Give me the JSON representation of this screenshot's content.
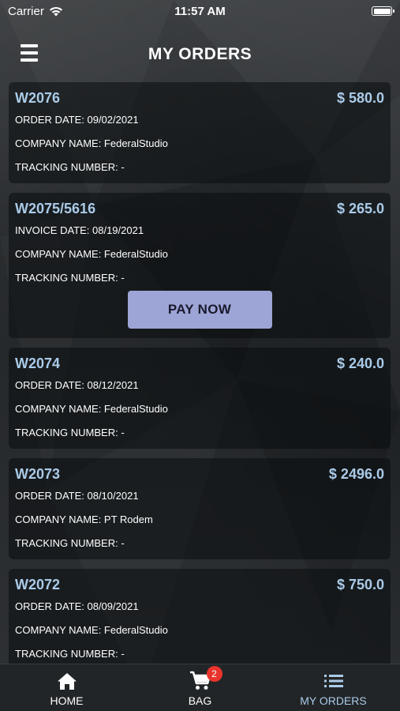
{
  "status_bar": {
    "carrier": "Carrier",
    "time": "11:57 AM"
  },
  "header": {
    "title": "MY ORDERS",
    "menu_icon": "hamburger-menu-icon"
  },
  "orders": [
    {
      "id": "W2076",
      "amount": "$ 580.0",
      "date_line": "ORDER DATE: 09/02/2021",
      "company_line": "COMPANY NAME: FederalStudio",
      "tracking_line": "TRACKING NUMBER: -"
    },
    {
      "id": "W2075/5616",
      "amount": "$ 265.0",
      "date_line": "INVOICE DATE: 08/19/2021",
      "company_line": "COMPANY NAME: FederalStudio",
      "tracking_line": "TRACKING NUMBER: -",
      "pay_label": "PAY NOW"
    },
    {
      "id": "W2074",
      "amount": "$ 240.0",
      "date_line": "ORDER DATE: 08/12/2021",
      "company_line": "COMPANY NAME: FederalStudio",
      "tracking_line": "TRACKING NUMBER: -"
    },
    {
      "id": "W2073",
      "amount": "$ 2496.0",
      "date_line": "ORDER DATE: 08/10/2021",
      "company_line": "COMPANY NAME: PT Rodem",
      "tracking_line": "TRACKING NUMBER: -"
    },
    {
      "id": "W2072",
      "amount": "$ 750.0",
      "date_line": "ORDER DATE: 08/09/2021",
      "company_line": "COMPANY NAME: FederalStudio",
      "tracking_line": "TRACKING NUMBER: -"
    }
  ],
  "tab_bar": {
    "tabs": [
      {
        "label": "HOME",
        "icon": "home-icon"
      },
      {
        "label": "BAG",
        "icon": "cart-icon",
        "badge": "2"
      },
      {
        "label": "MY ORDERS",
        "icon": "list-icon",
        "active": true
      }
    ]
  },
  "colors": {
    "accent": "#aacbe8",
    "pay_button": "#9da5d6",
    "badge": "#e8342c"
  }
}
